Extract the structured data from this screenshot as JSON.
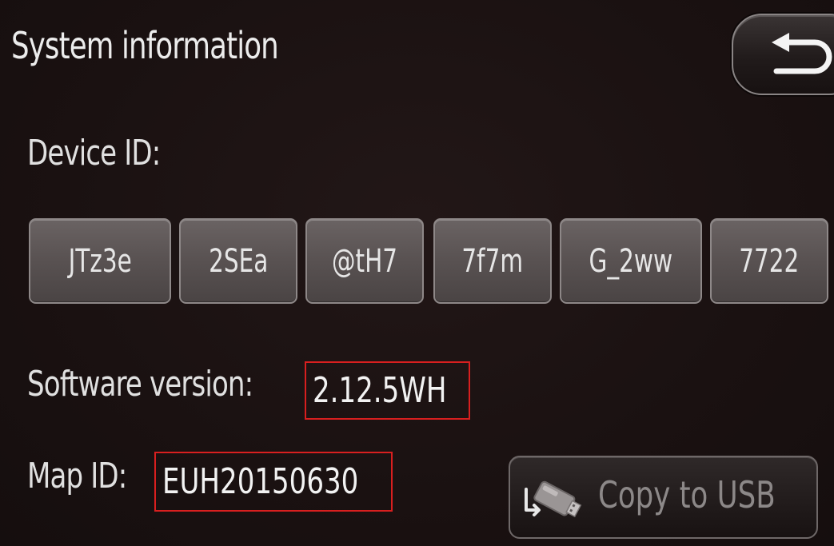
{
  "header": {
    "title": "System information",
    "back_icon": "return-arrow-icon"
  },
  "device": {
    "label": "Device ID:",
    "segments": [
      "JTz3e",
      "2SEa",
      "@tH7",
      "7f7m",
      "G_2ww",
      "7722"
    ]
  },
  "software": {
    "label": "Software version:",
    "value": "2.12.5WH"
  },
  "map": {
    "label": "Map ID:",
    "value": "EUH20150630"
  },
  "actions": {
    "copy_label": "Copy to USB",
    "copy_icon": "usb-stick-icon"
  },
  "colors": {
    "background": "#1b1212",
    "highlight": "#d81f1f",
    "chip": "#5a5353"
  }
}
